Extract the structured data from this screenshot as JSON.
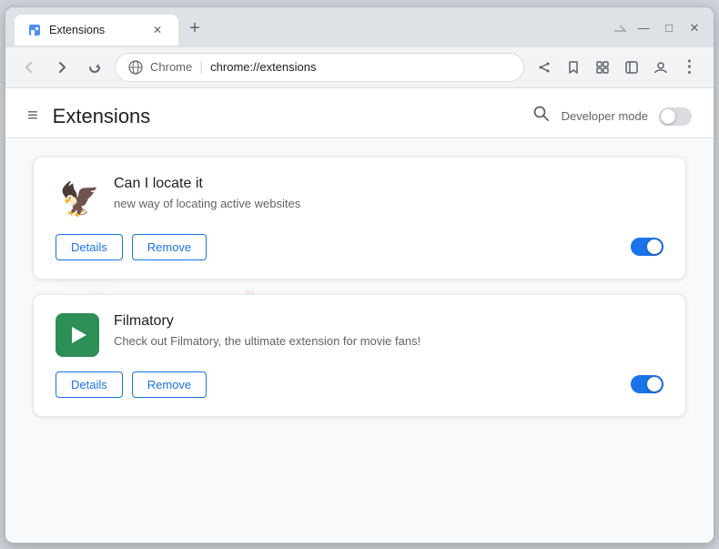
{
  "window": {
    "title": "Extensions",
    "tab_label": "Extensions",
    "url_bar": "chrome://extensions",
    "chrome_label": "Chrome",
    "controls": {
      "minimize": "—",
      "maximize": "□",
      "close": "✕"
    }
  },
  "nav": {
    "back_label": "←",
    "forward_label": "→",
    "refresh_label": "↻"
  },
  "page": {
    "title": "Extensions",
    "menu_icon": "≡",
    "search_icon": "🔍",
    "developer_mode_label": "Developer mode"
  },
  "extensions": [
    {
      "id": "can-locate-it",
      "name": "Can I locate it",
      "description": "new way of locating active websites",
      "enabled": true,
      "details_label": "Details",
      "remove_label": "Remove"
    },
    {
      "id": "filmatory",
      "name": "Filmatory",
      "description": "Check out Filmatory, the ultimate extension for movie fans!",
      "enabled": true,
      "details_label": "Details",
      "remove_label": "Remove"
    }
  ],
  "watermark": {
    "text": "risp.com"
  }
}
